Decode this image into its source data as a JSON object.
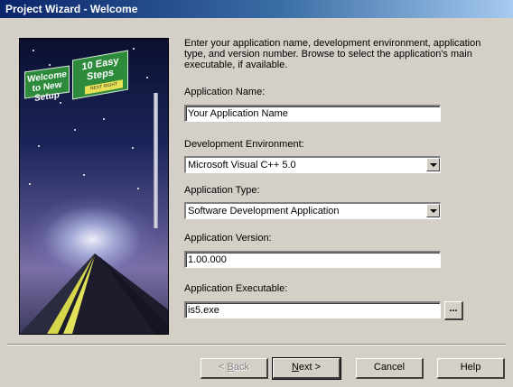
{
  "window": {
    "title": "Project Wizard - Welcome"
  },
  "banner": {
    "sign_left": "Welcome to New Setup",
    "sign_right": "10 Easy Steps",
    "sign_tag": "NEXT RIGHT"
  },
  "description": "Enter your application name, development environment, application type, and version number.  Browse to select the application's main executable, if available.",
  "fields": {
    "app_name": {
      "label": "Application Name:",
      "value": "Your Application Name"
    },
    "dev_env": {
      "label": "Development Environment:",
      "value": "Microsoft Visual C++ 5.0"
    },
    "app_type": {
      "label": "Application Type:",
      "value": "Software Development Application"
    },
    "app_version": {
      "label": "Application Version:",
      "value": "1.00.000"
    },
    "app_exe": {
      "label": "Application Executable:",
      "value": "is5.exe",
      "browse_label": "..."
    }
  },
  "buttons": {
    "back": {
      "pre": "< ",
      "mnemonic": "B",
      "post": "ack"
    },
    "next": {
      "mnemonic": "N",
      "post": "ext >"
    },
    "cancel": "Cancel",
    "help": "Help"
  }
}
